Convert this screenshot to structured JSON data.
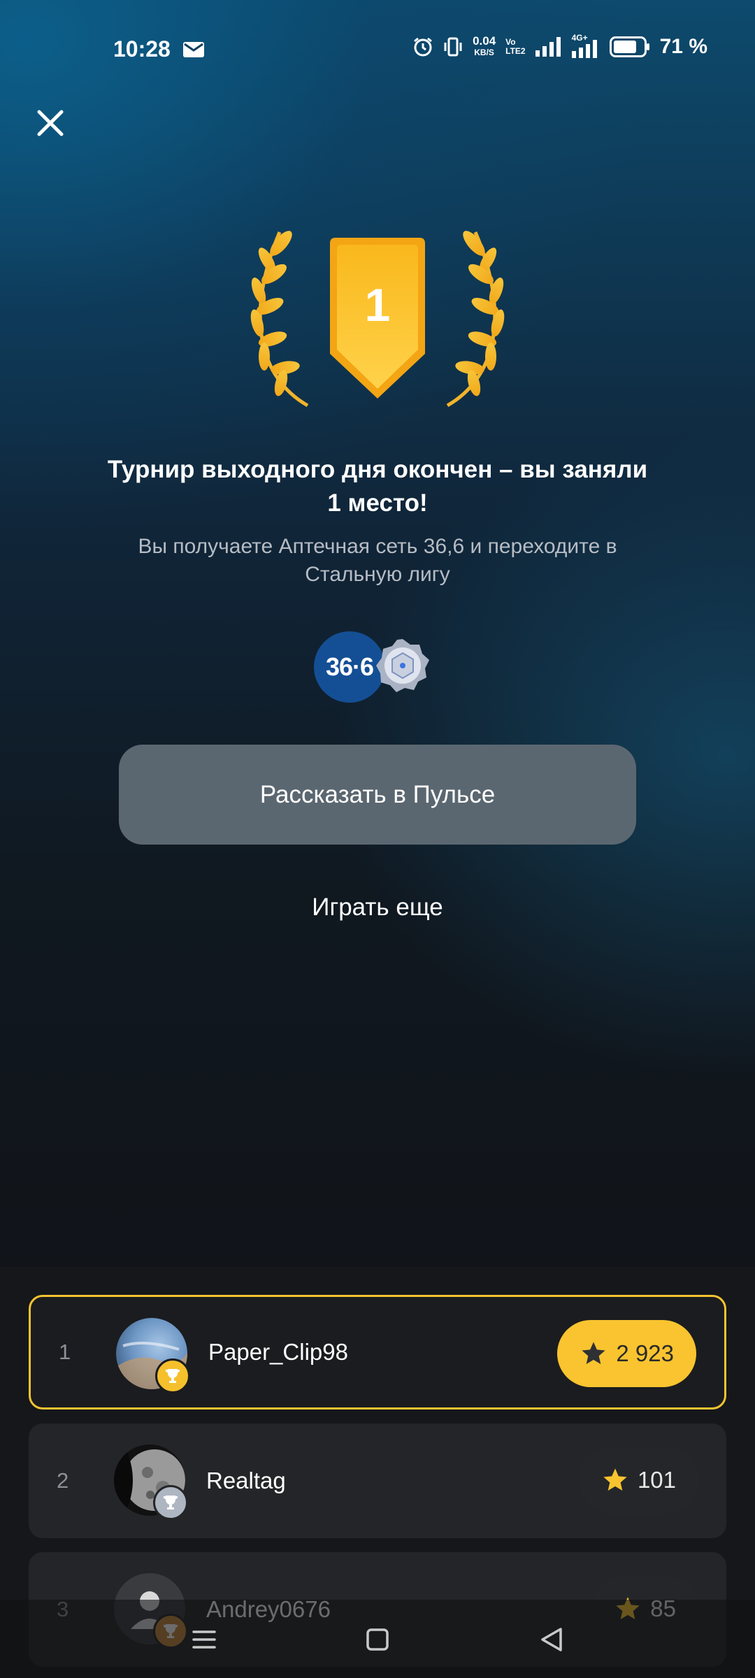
{
  "status_bar": {
    "time": "10:28",
    "net_speed_value": "0.04",
    "net_speed_unit": "KB/S",
    "volte_top": "Vo",
    "volte_bottom": "LTE2",
    "network_type": "4G+",
    "battery_percent": "71 %"
  },
  "result": {
    "place_number": "1",
    "title": "Турнир выходного дня окончен – вы заняли 1 место!",
    "subtitle": "Вы получаете Аптечная сеть 36,6 и переходите в Стальную лигу",
    "reward_logo_text": "36·6",
    "share_button_label": "Рассказать в Пульсе",
    "play_again_label": "Играть еще"
  },
  "leaderboard": [
    {
      "rank": "1",
      "name": "Paper_Clip98",
      "score": "2 923",
      "highlight": true
    },
    {
      "rank": "2",
      "name": "Realtag",
      "score": "101",
      "highlight": false
    },
    {
      "rank": "3",
      "name": "Andrey0676",
      "score": "85",
      "highlight": false
    }
  ],
  "colors": {
    "accent_gold": "#f9c42f",
    "button_gray": "#5b6770",
    "background_dark": "#101216",
    "reward_logo_blue": "#144f95"
  },
  "icons": [
    "close-icon",
    "laurel-left-icon",
    "laurel-right-icon",
    "shield-badge-icon",
    "league-steel-icon",
    "star-icon",
    "trophy-icon",
    "mail-icon",
    "alarm-icon",
    "vibrate-icon",
    "signal-icon",
    "battery-icon",
    "menu-icon",
    "home-icon",
    "back-icon"
  ]
}
